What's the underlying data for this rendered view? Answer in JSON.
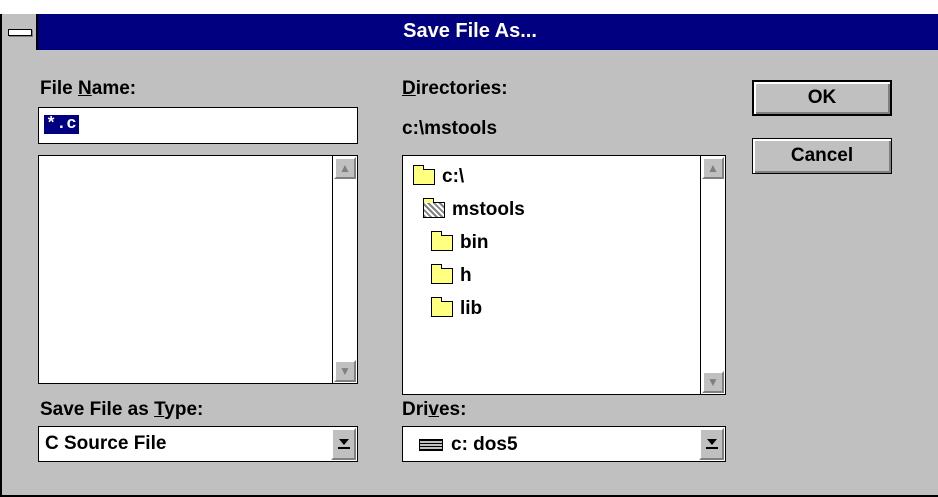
{
  "window": {
    "title": "Save File As..."
  },
  "file_name": {
    "label_prefix": "File ",
    "label_accel": "N",
    "label_suffix": "ame:",
    "value": "*.c"
  },
  "directories": {
    "label_accel": "D",
    "label_suffix": "irectories:",
    "current_path": "c:\\mstools",
    "items": [
      {
        "label": "c:\\",
        "icon": "open-folder-icon"
      },
      {
        "label": "mstools",
        "icon": "open-folder-selected-icon"
      },
      {
        "label": "bin",
        "icon": "folder-icon"
      },
      {
        "label": "h",
        "icon": "folder-icon"
      },
      {
        "label": "lib",
        "icon": "folder-icon"
      }
    ]
  },
  "save_type": {
    "label_prefix": "Save File as ",
    "label_accel": "T",
    "label_suffix": "ype:",
    "value": "C Source File"
  },
  "drives": {
    "label_prefix": "Dri",
    "label_accel": "v",
    "label_suffix": "es:",
    "value": "c: dos5"
  },
  "buttons": {
    "ok": "OK",
    "cancel": "Cancel"
  },
  "colors": {
    "title_bar": "#000080",
    "face": "#c0c0c0",
    "folder": "#ffff80"
  }
}
